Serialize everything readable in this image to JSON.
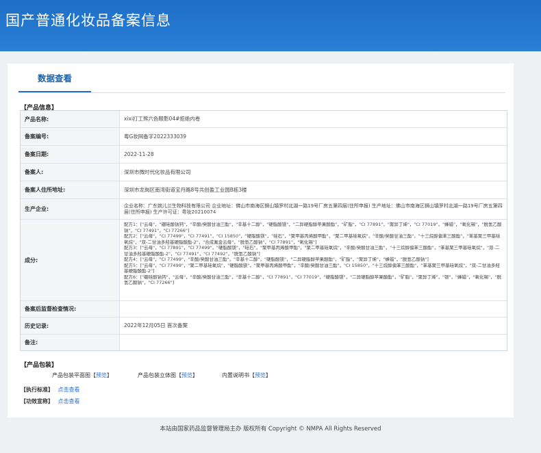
{
  "header": {
    "title": "国产普通化妆品备案信息"
  },
  "tabs": [
    {
      "label": "数据查看"
    }
  ],
  "sections": {
    "product_info": "【产品信息】",
    "product_package": "【产品包装】",
    "exec_standard": "【执行标准】",
    "efficacy": "【功效宣称】"
  },
  "fields": [
    {
      "label": "产品名称:",
      "value": "xixi打工熊六色眼影04#拒绝内卷"
    },
    {
      "label": "备案编号:",
      "value": "粤G妆网备字2022333039"
    },
    {
      "label": "备案日期:",
      "value": "2022-11-28"
    },
    {
      "label": "备案人:",
      "value": "深圳市微时代化妆品有限公司"
    },
    {
      "label": "备案人住所地址:",
      "value": "深圳市龙岗区南湾街道宝丹路8号共创盈工业园B栋3楼"
    },
    {
      "label": "生产企业:",
      "value": "企业名称：广东婉儿兰生物科技有限公司 企业地址：佛山市南海区狮山镇罗村北湖一路19号厂房五第四层(住所申报) 生产地址：佛山市南海区狮山镇罗村北湖一路19号厂房五第四层(住所申报) 生产许可证：粤妆20210074"
    },
    {
      "label": "成分:",
      "value": "配方1：[\"云母\"，\"硼硅酸钠钙\"，\"辛酸/癸酸甘油三酯\"，\"辛基十二醇\"，\"硬脂酸镁\"，\"二异硬脂醇苹果酸酯\"，\"矿脂\"，\"CI 77891\"，\"聚异丁烯\"，\"CI 77019\"，\"蜂蜡\"，\"氧化锡\"，\"脱氢乙酸钠\"，\"CI 77491\"，\"CI 77266\"]\n配方2：[\"云母\"，\"CI 77499\"，\"CI 77491\"，\"CI 15850\"，\"硬脂酸镁\"，\"硅石\"，\"聚甲基丙烯酸甲酯\"，\"聚二甲基硅氧烷\"，\"辛酸/癸酸甘油三酯\"，\"十三烷醇偏苯三酸酯\"，\"苯基聚三甲基硅氧烷\"，\"双-二甘油多羟基硬脂酸酯-2\"，\"合成氟金云母\"，\"脱氢乙酸钠\"，\"CI 77891\"，\"氧化锡\"]\n配方3：[\"云母\"，\"CI 77891\"，\"CI 77499\"，\"硬脂酸镁\"，\"硅石\"，\"聚甲基丙烯酸甲酯\"，\"聚二甲基硅氧烷\"，\"辛酸/癸酸甘油三酯\"，\"十三烷醇偏苯三酸酯\"，\"苯基聚三甲基硅氧烷\"，\"双-二甘油多羟基硬脂酸酯-2\"，\"CI 77491\"，\"CI 77492\"，\"脱氢乙酸钠\"]\n配方4：[\"云母\"，\"CI 77499\"，\"辛酸/癸酸甘油三酯\"，\"辛基十二醇\"，\"硬脂酸镁\"，\"二异硬脂醇苹果酸酯\"，\"矿脂\"，\"聚异丁烯\"，\"蜂蜡\"，\"脱氢乙酸钠\"]\n配方5：[\"云母\"，\"CI 77499\"，\"聚二甲基硅氧烷\"，\"硬脂酸镁\"，\"聚甲基丙烯酸甲酯\"，\"辛酸/癸酸甘油三酯\"，\"CI 15850\"，\"十三烷醇偏苯三酸酯\"，\"苯基聚三甲基硅氧烷\"，\"双-二甘油多羟基硬脂酸酯-2\"]\n配方6：[\"硼硅酸钠钙\"，\"云母\"，\"辛酸/癸酸甘油三酯\"，\"辛基十二醇\"，\"CI 77891\"，\"CI 77019\"，\"硬脂酸镁\"，\"二异硬脂醇苹果酸酯\"，\"矿脂\"，\"聚异丁烯\"，\"银\"，\"蜂蜡\"，\"氧化锡\"，\"脱氢乙酸钠\"，\"CI 77266\"]"
    },
    {
      "label": "备案后监督检查情况:",
      "value": ""
    },
    {
      "label": "历史记录:",
      "value": "2022年12月05日 首次备案"
    },
    {
      "label": "备注:",
      "value": ""
    }
  ],
  "package": {
    "items": [
      {
        "label": "产品包装平面图",
        "link": "预览"
      },
      {
        "label": "产品包装立体图",
        "link": "预览"
      },
      {
        "label": "内置说明书",
        "link": "预览"
      }
    ]
  },
  "exec_link": "点击查看",
  "efficacy_link": "点击查看",
  "footer": "本站由国家药品监督管理局主办 版权所有 Copyright © NMPA All Rights Reserved",
  "colors": {
    "banner": "#1f6fc6",
    "link": "#2a6fd0"
  }
}
